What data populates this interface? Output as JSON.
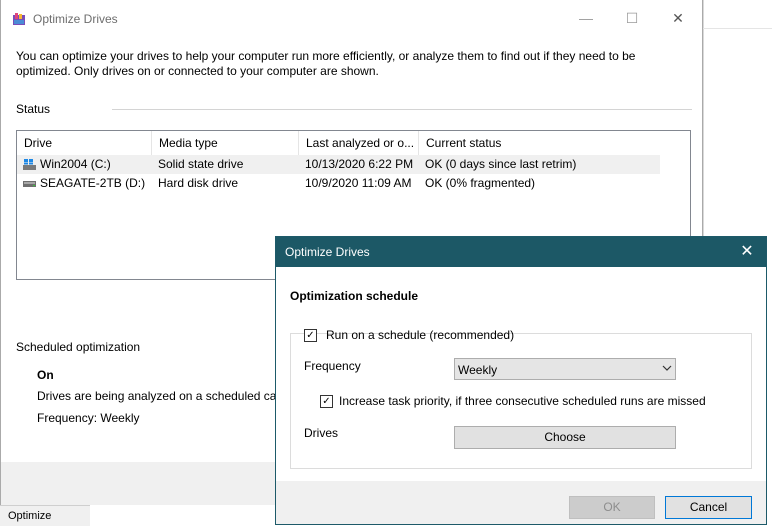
{
  "main_window": {
    "title": "Optimize Drives",
    "description": "You can optimize your drives to help your computer run more efficiently, or analyze them to find out if they need to be optimized. Only drives on or connected to your computer are shown.",
    "status_label": "Status",
    "columns": [
      "Drive",
      "Media type",
      "Last analyzed or o...",
      "Current status"
    ],
    "drives": [
      {
        "name": "Win2004 (C:)",
        "media": "Solid state drive",
        "last": "10/13/2020 6:22 PM",
        "status": "OK (0 days since last retrim)"
      },
      {
        "name": "SEAGATE-2TB (D:)",
        "media": "Hard disk drive",
        "last": "10/9/2020 11:09 AM",
        "status": "OK (0% fragmented)"
      }
    ],
    "scheduled_label": "Scheduled optimization",
    "scheduled_state": "On",
    "scheduled_desc": "Drives are being analyzed on a scheduled cad",
    "frequency_text": "Frequency: Weekly"
  },
  "background": {
    "taskbar_label": "Optimize"
  },
  "dialog": {
    "title": "Optimize Drives",
    "section_title": "Optimization schedule",
    "run_schedule_label": "Run on a schedule (recommended)",
    "frequency_label": "Frequency",
    "frequency_value": "Weekly",
    "priority_label": "Increase task priority, if three consecutive scheduled runs are missed",
    "drives_label": "Drives",
    "choose_label": "Choose",
    "ok_label": "OK",
    "cancel_label": "Cancel"
  },
  "glyphs": {
    "check": "✓",
    "close": "✕",
    "minimize": "—",
    "maximize": "☐"
  },
  "colors": {
    "dialog_titlebar": "#1c5866",
    "selected_row": "#f0f0f0",
    "primary_border": "#0078d7"
  }
}
